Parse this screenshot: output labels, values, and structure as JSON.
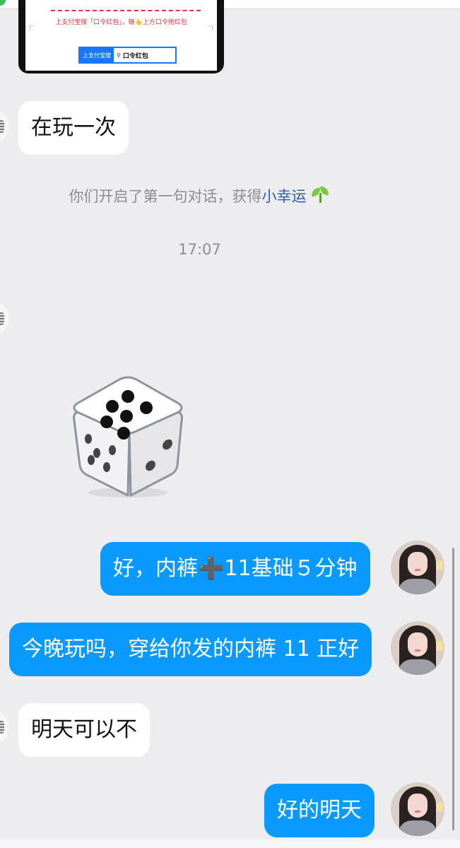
{
  "image_card": {
    "instruction_text": "上支付宝搜「口令红包」，输👆上方口令抢红包",
    "search_label": "上支付宝搜",
    "search_keyword": "口令红包"
  },
  "messages": [
    {
      "id": "m1",
      "direction": "incoming",
      "text": "在玩一次"
    },
    {
      "id": "m4",
      "direction": "outgoing",
      "text": "好，内裤➕11基础５分钟"
    },
    {
      "id": "m5",
      "direction": "outgoing",
      "text": "今晚玩吗，穿给你发的内裤 11 正好"
    },
    {
      "id": "m6",
      "direction": "incoming",
      "text": "明天可以不"
    },
    {
      "id": "m7",
      "direction": "outgoing",
      "text": "好的明天"
    }
  ],
  "system": {
    "prefix": "你们开启了第一句对话，获得",
    "highlight": "小幸运",
    "icon": "sprout-icon"
  },
  "timestamp": "17:07",
  "dice": {
    "value": 5
  },
  "colors": {
    "outgoing_bubble": "#0a99ff",
    "incoming_bubble": "#ffffff",
    "background": "#ededf0",
    "highlight": "#2a5db0",
    "alipay_blue": "#1677ff"
  }
}
